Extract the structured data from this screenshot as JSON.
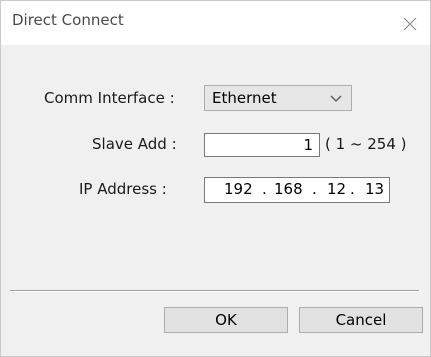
{
  "window": {
    "title": "Direct Connect",
    "close_glyph": "✕"
  },
  "form": {
    "comm_interface_label": "Comm Interface :",
    "comm_interface_value": "Ethernet",
    "slave_add_label": "Slave Add :",
    "slave_add_value": "1",
    "slave_add_range": "( 1 ~ 254 )",
    "ip_label": "IP Address :",
    "ip_octets": [
      "192",
      "168",
      "12",
      "13"
    ],
    "ip_separator": "."
  },
  "buttons": {
    "ok": "OK",
    "cancel": "Cancel"
  },
  "icons": {
    "close": "close-icon",
    "dropdown": "chevron-down-icon"
  }
}
